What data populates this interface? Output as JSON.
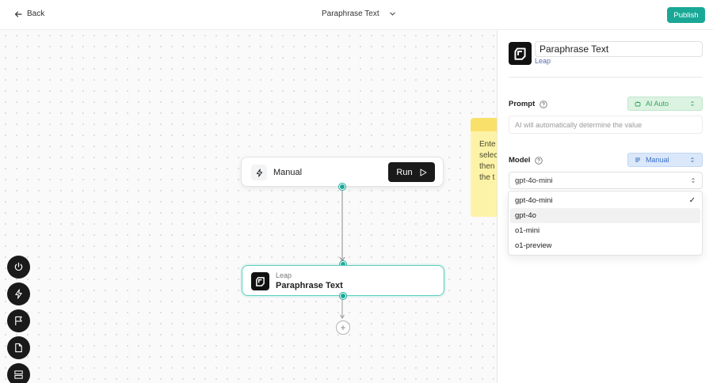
{
  "header": {
    "back_label": "Back",
    "title": "Paraphrase Text",
    "publish_label": "Publish"
  },
  "canvas": {
    "sticky_text": "Ente\nselec\nthen\nthe t",
    "manual_node": {
      "label": "Manual",
      "run_label": "Run"
    },
    "leap_node": {
      "subtitle": "Leap",
      "title": "Paraphrase Text"
    },
    "add_symbol": "+",
    "toolbar": [
      "power-icon",
      "bolt-icon",
      "flag-icon",
      "file-icon",
      "layout-icon"
    ]
  },
  "panel": {
    "name_value": "Paraphrase Text",
    "subtitle": "Leap",
    "prompt": {
      "label": "Prompt",
      "mode": "AI Auto",
      "placeholder": "AI will automatically determine the value"
    },
    "model": {
      "label": "Model",
      "mode": "Manual",
      "selected": "gpt-4o-mini",
      "options": [
        {
          "label": "gpt-4o-mini",
          "checked": true
        },
        {
          "label": "gpt-4o",
          "hovered": true
        },
        {
          "label": "o1-mini"
        },
        {
          "label": "o1-preview"
        }
      ],
      "check_mark": "✓"
    }
  },
  "colors": {
    "accent": "#1aa896",
    "ai_green": "#2fa65a",
    "manual_blue": "#3b6fc4",
    "sticky": "#fdf3a8"
  }
}
